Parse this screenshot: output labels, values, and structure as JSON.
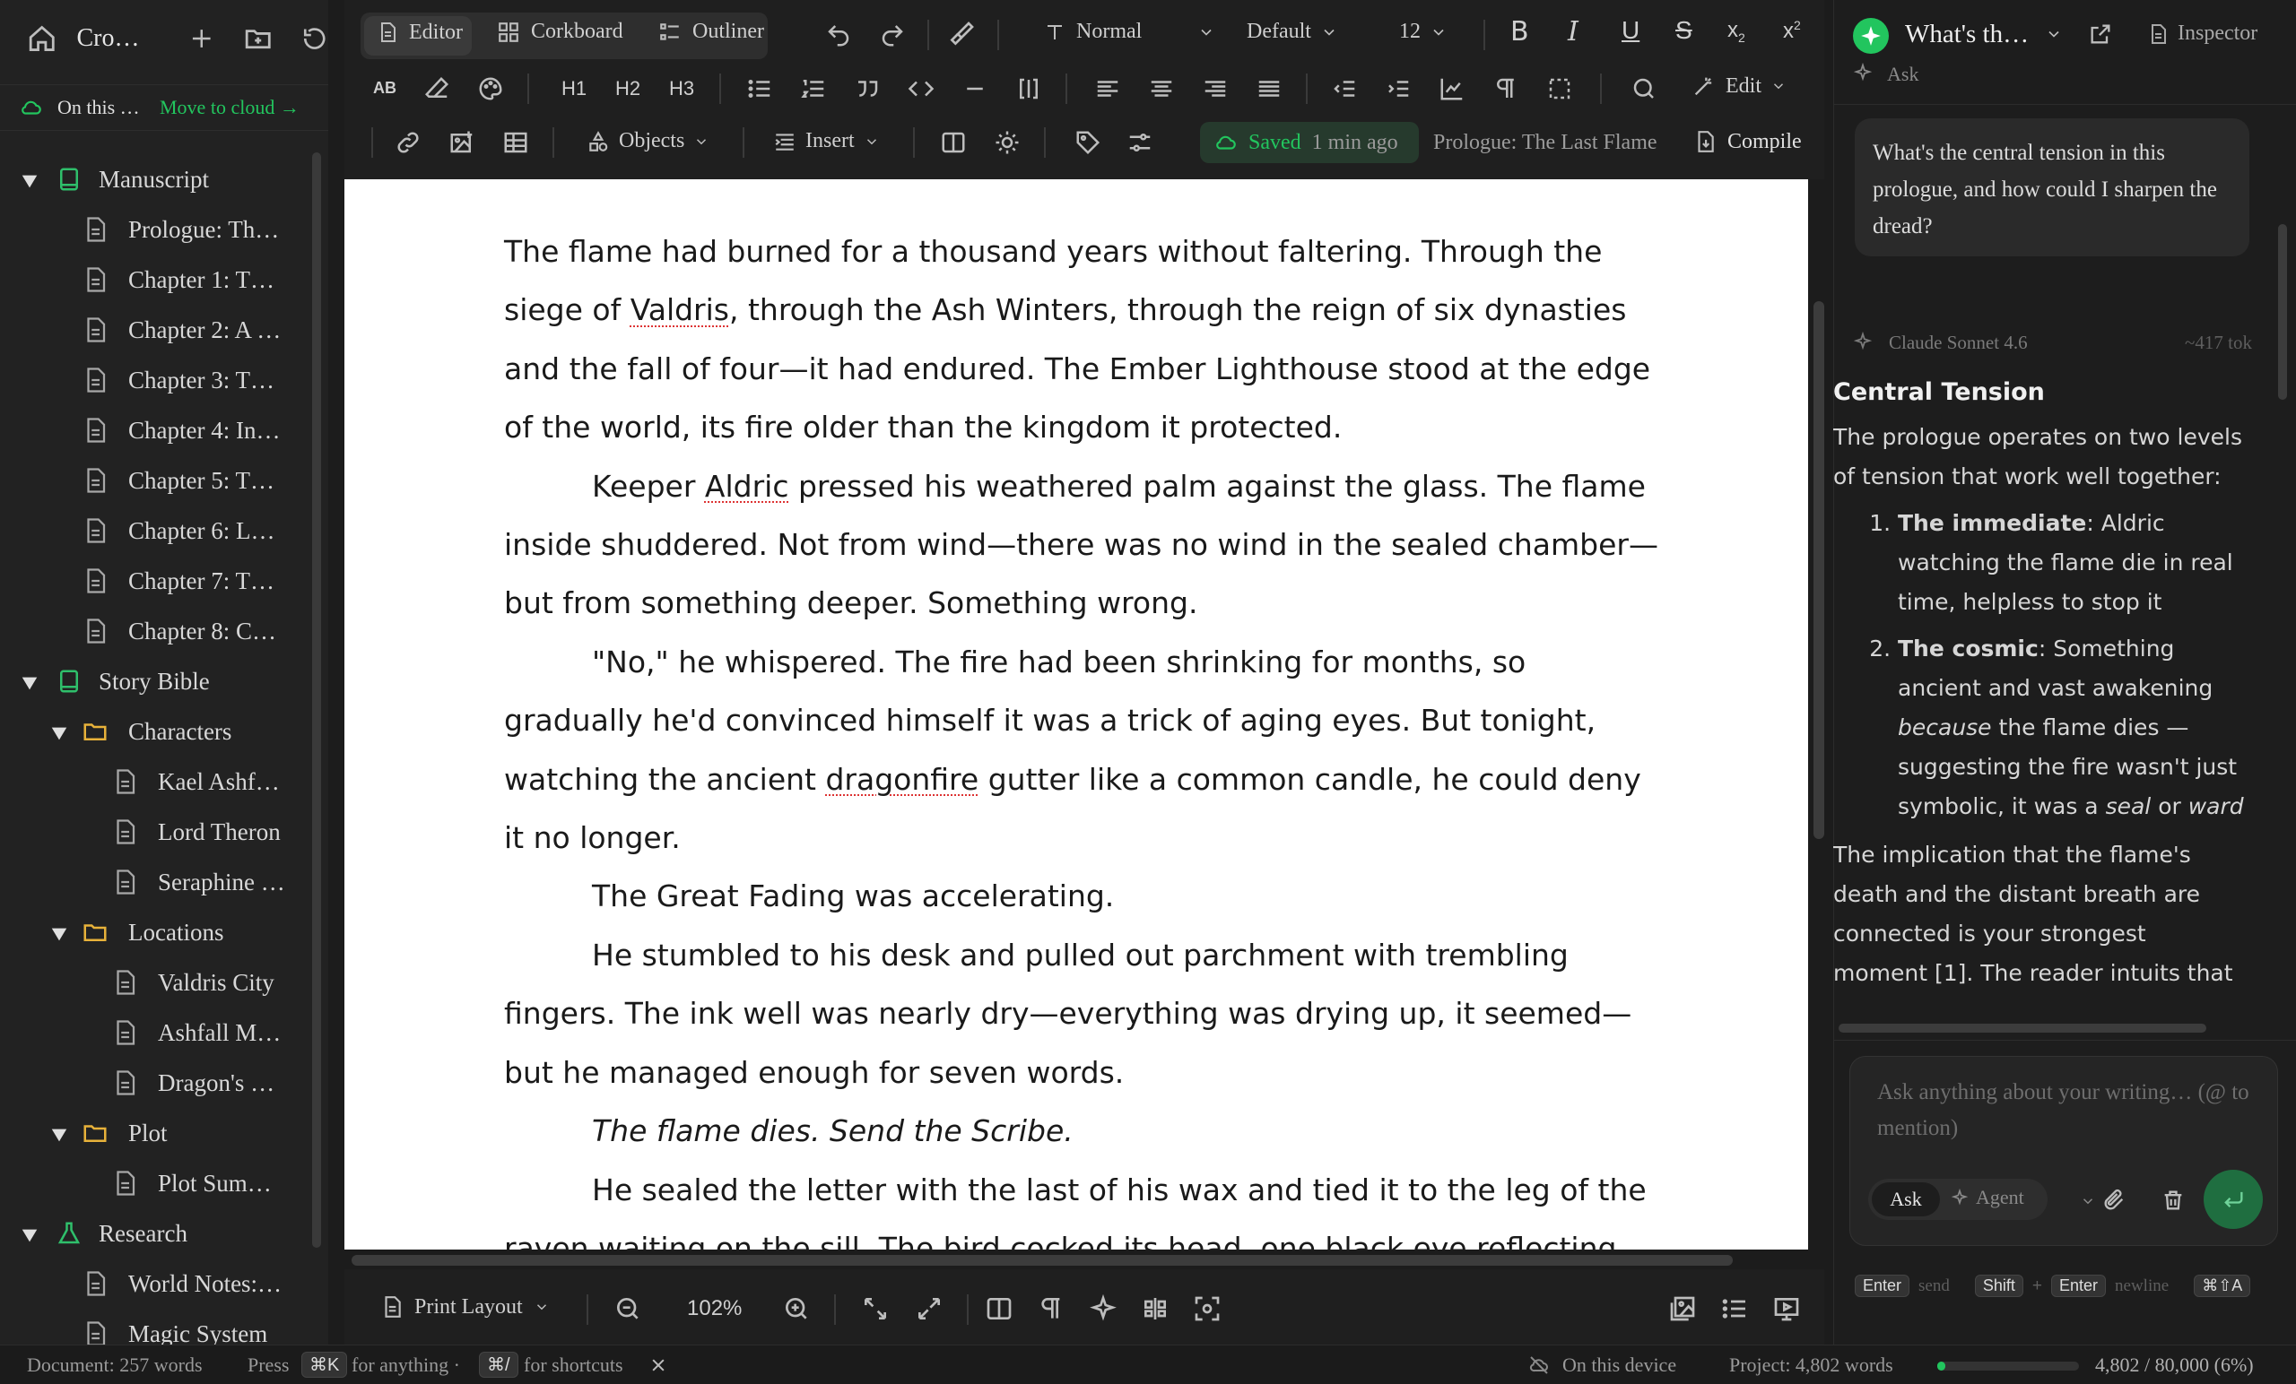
{
  "sidebar": {
    "project_title": "Cro…",
    "cloud_status": "On this …",
    "cloud_action": "Move to cloud →",
    "tree": [
      {
        "label": "Manuscript",
        "icon": "book-icon",
        "level": 0,
        "expanded": true
      },
      {
        "label": "Prologue: Th…",
        "icon": "document-icon",
        "level": 1
      },
      {
        "label": "Chapter 1: T…",
        "icon": "document-icon",
        "level": 1
      },
      {
        "label": "Chapter 2: A …",
        "icon": "document-icon",
        "level": 1
      },
      {
        "label": "Chapter 3: T…",
        "icon": "document-icon",
        "level": 1
      },
      {
        "label": "Chapter 4: In…",
        "icon": "document-icon",
        "level": 1
      },
      {
        "label": "Chapter 5: T…",
        "icon": "document-icon",
        "level": 1
      },
      {
        "label": "Chapter 6: L…",
        "icon": "document-icon",
        "level": 1
      },
      {
        "label": "Chapter 7: T…",
        "icon": "document-icon",
        "level": 1
      },
      {
        "label": "Chapter 8: C…",
        "icon": "document-icon",
        "level": 1
      },
      {
        "label": "Story Bible",
        "icon": "book-icon",
        "level": 0,
        "expanded": true
      },
      {
        "label": "Characters",
        "icon": "folder-icon",
        "level": 1,
        "expanded": true
      },
      {
        "label": "Kael Ashf…",
        "icon": "document-icon",
        "level": 2
      },
      {
        "label": "Lord Theron",
        "icon": "document-icon",
        "level": 2
      },
      {
        "label": "Seraphine …",
        "icon": "document-icon",
        "level": 2
      },
      {
        "label": "Locations",
        "icon": "folder-icon",
        "level": 1,
        "expanded": true
      },
      {
        "label": "Valdris City",
        "icon": "document-icon",
        "level": 2
      },
      {
        "label": "Ashfall M…",
        "icon": "document-icon",
        "level": 2
      },
      {
        "label": "Dragon's …",
        "icon": "document-icon",
        "level": 2
      },
      {
        "label": "Plot",
        "icon": "folder-icon",
        "level": 1,
        "expanded": true
      },
      {
        "label": "Plot Sum…",
        "icon": "document-icon",
        "level": 2
      },
      {
        "label": "Research",
        "icon": "flask-icon",
        "level": 0,
        "expanded": true
      },
      {
        "label": "World Notes:…",
        "icon": "document-icon",
        "level": 1
      },
      {
        "label": "Magic System",
        "icon": "document-icon",
        "level": 1
      }
    ]
  },
  "toolbar": {
    "view_tabs": [
      "Editor",
      "Corkboard",
      "Outliner"
    ],
    "style": "Normal",
    "font": "Default",
    "size": "12",
    "headings": [
      "H1",
      "H2",
      "H3"
    ],
    "edit_label": "Edit",
    "objects_label": "Objects",
    "insert_label": "Insert",
    "saved_label": "Saved",
    "saved_time": "1 min ago",
    "doc_title": "Prologue: The Last Flame",
    "compile_label": "Compile"
  },
  "document": {
    "paragraphs": [
      {
        "style": "first",
        "text": "The flame had burned for a thousand years without faltering. Through the siege of Valdris, through the Ash Winters, through the reign of six dynasties and the fall of four—it had endured. The Ember Lighthouse stood at the edge of the world, its fire older than the kingdom it protected."
      },
      {
        "style": "indent",
        "text": "Keeper Aldric pressed his weathered palm against the glass. The flame inside shuddered. Not from wind—there was no wind in the sealed chamber—but from something deeper. Something wrong."
      },
      {
        "style": "indent",
        "text": "\"No,\" he whispered. The fire had been shrinking for months, so gradually he'd convinced himself it was a trick of aging eyes. But tonight, watching the ancient dragonfire gutter like a common candle, he could deny it no longer."
      },
      {
        "style": "indent",
        "text": "The Great Fading was accelerating."
      },
      {
        "style": "indent",
        "text": "He stumbled to his desk and pulled out parchment with trembling fingers. The ink well was nearly dry—everything was drying up, it seemed—but he managed enough for seven words."
      },
      {
        "style": "indent-italic",
        "text": "The flame dies. Send the Scribe."
      },
      {
        "style": "indent",
        "text": "He sealed the letter with the last of his wax and tied it to the leg of the raven waiting on the sill. The bird cocked its head, one black eye reflecting"
      }
    ],
    "misspelled": [
      "Valdris",
      "Aldric",
      "dragonfire"
    ]
  },
  "bottombar": {
    "layout_label": "Print Layout",
    "zoom": "102%"
  },
  "status": {
    "doc_words": "Document: 257 words",
    "press": "Press",
    "key1": "⌘K",
    "for_anything": "for anything ·",
    "key2": "⌘/",
    "for_shortcuts": "for shortcuts",
    "device": "On this device",
    "project_words": "Project: 4,802 words",
    "goal": "4,802 / 80,000 (6%)",
    "goal_progress": 0.06
  },
  "assistant": {
    "chat_title": "What's th…",
    "inspector_label": "Inspector",
    "mode_label": "Ask",
    "user_message": "What's the central tension in this prologue, and how could I sharpen the dread?",
    "model_name": "Claude Sonnet 4.6",
    "tokens": "~417 tok",
    "heading": "Central Tension",
    "intro": "The prologue operates on two levels of tension that work well together:",
    "item1_bold": "The immediate",
    "item1_text": ": Aldric watching the flame die in real time, helpless to stop it",
    "item2_bold": "The cosmic",
    "item2_text_a": ": Something ancient and vast awakening ",
    "item2_em": "because",
    "item2_text_b": " the flame dies — suggesting the fire wasn't just symbolic, it was a ",
    "item2_em2": "seal",
    "item2_text_c": " or ",
    "item2_em3": "ward",
    "para2": "The implication that the flame's death and the distant breath are connected is your strongest moment [1]. The reader intuits that",
    "input_placeholder": "Ask anything about your writing… (@ to mention)",
    "btn_ask": "Ask",
    "btn_agent": "Agent",
    "hint_enter": "Enter",
    "hint_send": "send",
    "hint_shift": "Shift",
    "hint_plus": "+",
    "hint_enter2": "Enter",
    "hint_newline": "newline",
    "hint_key": "⌘⇧A"
  },
  "colors": {
    "accent": "#22c55e",
    "folder": "#e8b23a",
    "book": "#2fbf6b",
    "editor_bg": "#ffffff"
  }
}
